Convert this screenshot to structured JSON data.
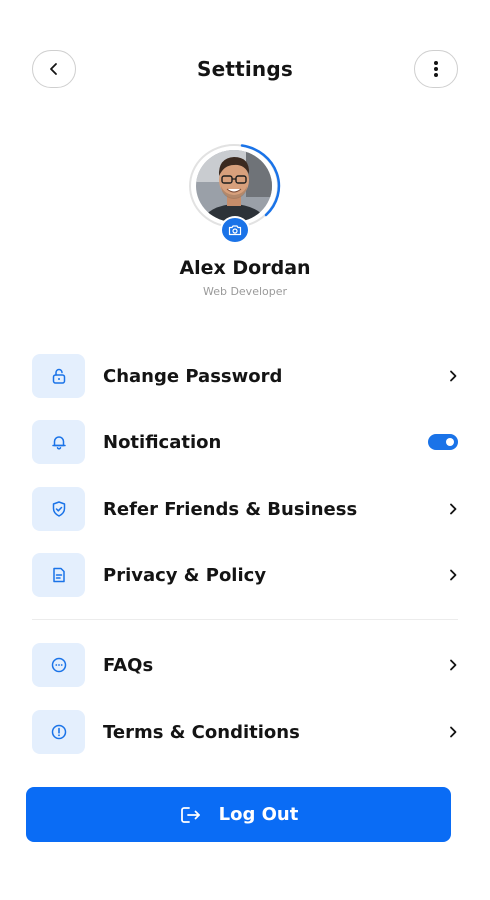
{
  "header": {
    "title": "Settings",
    "back_icon": "chevron-left-icon",
    "more_icon": "more-vertical-icon"
  },
  "profile": {
    "name": "Alex Dordan",
    "role": "Web Developer",
    "camera_icon": "camera-icon"
  },
  "menu": {
    "items": [
      {
        "label": "Change Password",
        "icon": "lock-icon",
        "trailing": "chevron"
      },
      {
        "label": "Notification",
        "icon": "bell-icon",
        "trailing": "toggle",
        "toggle_on": true
      },
      {
        "label": "Refer Friends & Business",
        "icon": "shield-check-icon",
        "trailing": "chevron"
      },
      {
        "label": "Privacy & Policy",
        "icon": "document-icon",
        "trailing": "chevron"
      },
      {
        "label": "FAQs",
        "icon": "chat-dots-icon",
        "trailing": "chevron"
      },
      {
        "label": "Terms & Conditions",
        "icon": "alert-circle-icon",
        "trailing": "chevron"
      }
    ]
  },
  "logout": {
    "label": "Log Out",
    "icon": "logout-icon"
  },
  "colors": {
    "accent": "#0a6cf5",
    "icon_box": "#e4effd",
    "text": "#141414",
    "muted": "#9a9a9a"
  }
}
